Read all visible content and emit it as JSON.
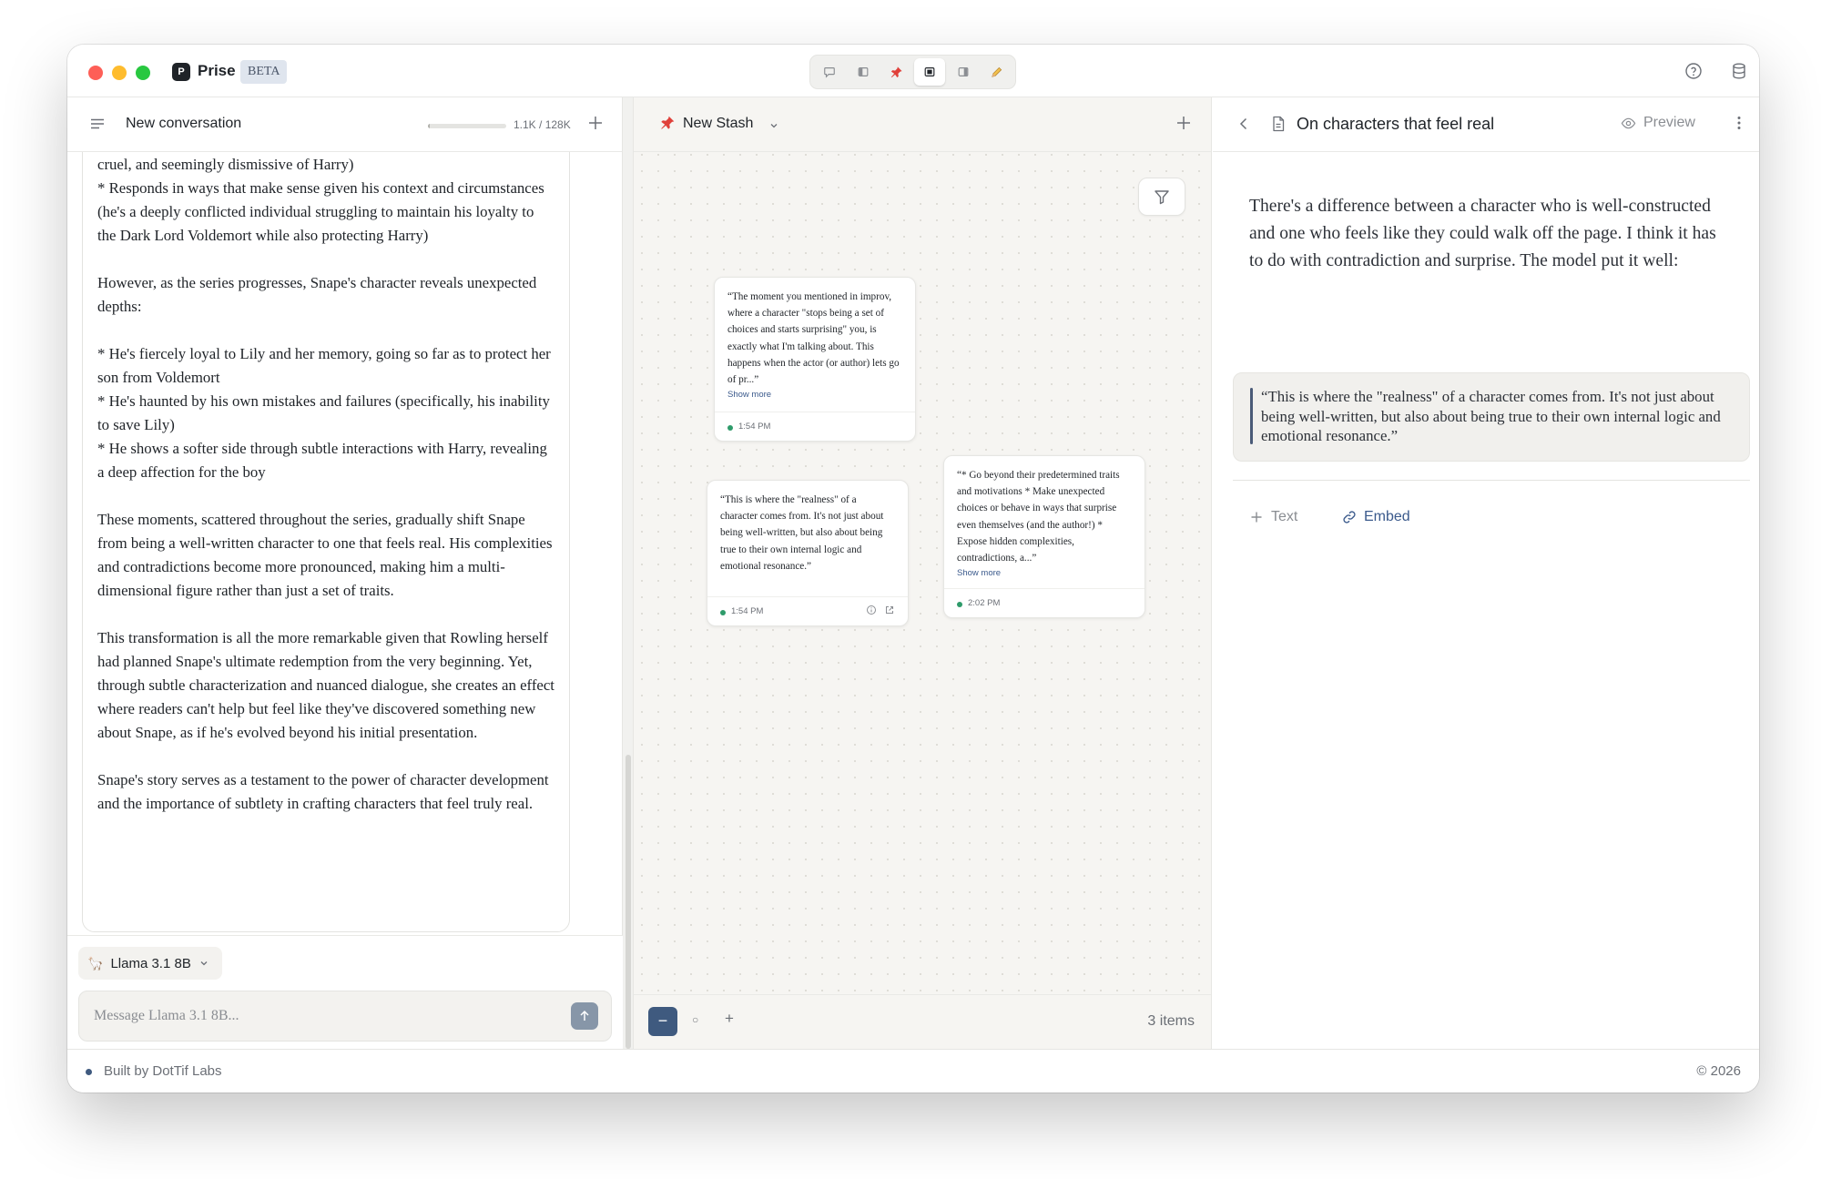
{
  "app": {
    "name": "Prise",
    "badge": "BETA",
    "logo_letter": "P"
  },
  "toolbar": {
    "icons": [
      "chat-bubble-icon",
      "panel-left-icon",
      "pin-icon",
      "panel-center-icon",
      "panel-right-icon",
      "pencil-icon"
    ],
    "active_index": 3
  },
  "title_right_icons": [
    "help-circle-icon",
    "database-icon"
  ],
  "chat": {
    "title": "New conversation",
    "context_usage": "1.1K / 128K",
    "context_fraction": 0.0086,
    "message_paragraphs": [
      "cruel, and seemingly dismissive of Harry)\n*  Responds in ways that make sense given his context and circumstances (he's a deeply conflicted individual struggling to maintain his loyalty to the Dark Lord Voldemort while also protecting Harry)",
      "However, as the series progresses, Snape's character reveals unexpected depths:",
      "*  He's fiercely loyal to Lily and her memory, going so far as to protect her son from Voldemort\n*  He's haunted by his own mistakes and failures (specifically, his inability to save Lily)\n*  He shows a softer side through subtle interactions with Harry, revealing a deep affection for the boy",
      "These moments, scattered throughout the series, gradually shift Snape from being a well-written character to one that feels real. His complexities and contradictions become more pronounced, making him a multi-dimensional figure rather than just a set of traits.",
      "This transformation is all the more remarkable given that Rowling herself had planned Snape's ultimate redemption from the very beginning. Yet, through subtle characterization and nuanced dialogue, she creates an effect where readers can't help but feel like they've discovered something new about Snape, as if he's evolved beyond his initial presentation.",
      "Snape's story serves as a testament to the power of character development and the importance of subtlety in crafting characters that feel truly real."
    ],
    "model_name": "Llama 3.1 8B",
    "model_emoji": "🦙",
    "input_value": "",
    "input_placeholder": "Message Llama 3.1 8B..."
  },
  "stash": {
    "title": "New Stash",
    "cards": [
      {
        "text": "“The moment you mentioned in improv, where a character \"stops being a set of choices and starts surprising\" you, is exactly what I'm talking about. This happens when the actor (or author) lets go of pr...”",
        "show_more": "Show more",
        "time": "1:54 PM"
      },
      {
        "text": "“This is where the \"realness\" of a character comes from. It's not just about being well-written, but also about being true to their own internal logic and emotional resonance.”",
        "show_more": "",
        "time": "1:54 PM"
      },
      {
        "text": "“* Go beyond their predetermined traits and motivations * Make unexpected choices or behave in ways that surprise even themselves (and the author!) * Expose hidden complexities, contradictions, a...”",
        "show_more": "Show more",
        "time": "2:02 PM"
      }
    ],
    "zoom_minus": "−",
    "zoom_reset": "○",
    "zoom_plus": "+",
    "items_count": "3 items"
  },
  "document": {
    "title": "On characters that feel real",
    "preview_label": "Preview",
    "body": "There's a difference between a character who is well-constructed and one who feels like they could walk off the page. I think it has to do with contradiction and surprise. The model put it well:",
    "quote": "“This is where the \"realness\" of a character comes from. It's not just about being well-written, but also about being true to their own internal logic and emotional resonance.”",
    "add_text_label": "Text",
    "add_embed_label": "Embed"
  },
  "status": {
    "left": "Built by DotTif Labs",
    "right": "©  2026"
  },
  "colors": {
    "accent": "#3f5a7f",
    "canvas_bg": "#f6f5f2",
    "online_dot": "#2e9b6a"
  }
}
